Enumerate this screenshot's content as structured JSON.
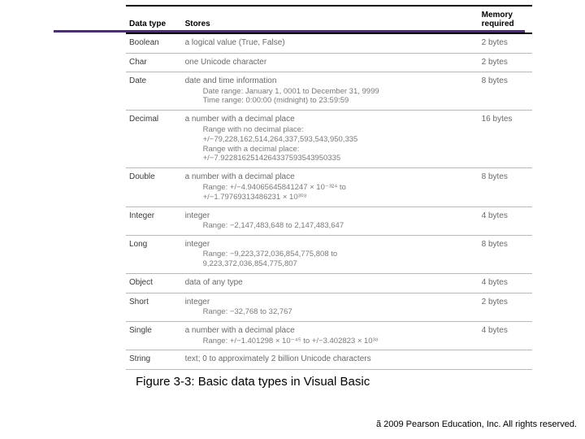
{
  "chart_data": {
    "type": "table",
    "title": "Figure 3-3: Basic data types in Visual Basic",
    "columns": [
      "Data type",
      "Stores",
      "Memory required"
    ],
    "rows": [
      {
        "type": "Boolean",
        "stores": "a logical value (True, False)",
        "details": [],
        "memory": "2 bytes"
      },
      {
        "type": "Char",
        "stores": "one Unicode character",
        "details": [],
        "memory": "2 bytes"
      },
      {
        "type": "Date",
        "stores": "date and time information",
        "details": [
          "Date range: January 1, 0001 to December 31, 9999",
          "Time range: 0:00:00 (midnight) to 23:59:59"
        ],
        "memory": "8 bytes"
      },
      {
        "type": "Decimal",
        "stores": "a number with a decimal place",
        "details": [
          "Range with no decimal place:",
          "+/−79,228,162,514,264,337,593,543,950,335",
          "Range with a decimal place:",
          "+/−7.9228162514264337593543950335"
        ],
        "memory": "16 bytes"
      },
      {
        "type": "Double",
        "stores": "a number with a decimal place",
        "details": [
          "Range: +/−4.94065645841247 × 10⁻³²⁴ to",
          "+/−1.79769313486231 × 10³⁰⁸"
        ],
        "memory": "8 bytes"
      },
      {
        "type": "Integer",
        "stores": "integer",
        "details": [
          "Range: −2,147,483,648 to 2,147,483,647"
        ],
        "memory": "4 bytes"
      },
      {
        "type": "Long",
        "stores": "integer",
        "details": [
          "Range: −9,223,372,036,854,775,808 to",
          "9,223,372,036,854,775,807"
        ],
        "memory": "8 bytes"
      },
      {
        "type": "Object",
        "stores": "data of any type",
        "details": [],
        "memory": "4 bytes"
      },
      {
        "type": "Short",
        "stores": "integer",
        "details": [
          "Range: −32,768 to 32,767"
        ],
        "memory": "2 bytes"
      },
      {
        "type": "Single",
        "stores": "a number with a decimal place",
        "details": [
          "Range: +/−1.401298 × 10⁻⁴⁵ to +/−3.402823 × 10³⁸"
        ],
        "memory": "4 bytes"
      },
      {
        "type": "String",
        "stores": "text; 0 to approximately 2 billion Unicode characters",
        "details": [],
        "memory": ""
      }
    ]
  },
  "header": {
    "col_type": "Data type",
    "col_stores": "Stores",
    "col_memory_l1": "Memory",
    "col_memory_l2": "required"
  },
  "rows": {
    "r0": {
      "type": "Boolean",
      "store": "a logical value (True, False)",
      "mem": "2 bytes"
    },
    "r1": {
      "type": "Char",
      "store": "one Unicode character",
      "mem": "2 bytes"
    },
    "r2": {
      "type": "Date",
      "store": "date and time information",
      "d1": "Date range: January 1, 0001 to December 31, 9999",
      "d2": "Time range: 0:00:00 (midnight) to 23:59:59",
      "mem": "8 bytes"
    },
    "r3": {
      "type": "Decimal",
      "store": "a number with a decimal place",
      "d1": "Range with no decimal place:",
      "d2": "+/−79,228,162,514,264,337,593,543,950,335",
      "d3": "Range with a decimal place:",
      "d4": "+/−7.9228162514264337593543950335",
      "mem": "16 bytes"
    },
    "r4": {
      "type": "Double",
      "store": "a number with a decimal place",
      "d1": "Range: +/−4.94065645841247 × 10⁻³²⁴ to",
      "d2": "+/−1.79769313486231 × 10³⁰⁸",
      "mem": "8 bytes"
    },
    "r5": {
      "type": "Integer",
      "store": "integer",
      "d1": "Range: −2,147,483,648 to 2,147,483,647",
      "mem": "4 bytes"
    },
    "r6": {
      "type": "Long",
      "store": "integer",
      "d1": "Range: −9,223,372,036,854,775,808 to",
      "d2": "9,223,372,036,854,775,807",
      "mem": "8 bytes"
    },
    "r7": {
      "type": "Object",
      "store": "data of any type",
      "mem": "4 bytes"
    },
    "r8": {
      "type": "Short",
      "store": "integer",
      "d1": "Range: −32,768 to 32,767",
      "mem": "2 bytes"
    },
    "r9": {
      "type": "Single",
      "store": "a number with a decimal place",
      "d1": "Range: +/−1.401298 × 10⁻⁴⁵ to +/−3.402823 × 10³⁸",
      "mem": "4 bytes"
    },
    "r10": {
      "type": "String",
      "store": "text; 0 to approximately 2 billion Unicode characters",
      "mem": ""
    }
  },
  "caption": "Figure 3-3: Basic data types in Visual Basic",
  "copyright": "  2009 Pearson Education, Inc.  All rights reserved.",
  "copyright_symbol": "ã"
}
